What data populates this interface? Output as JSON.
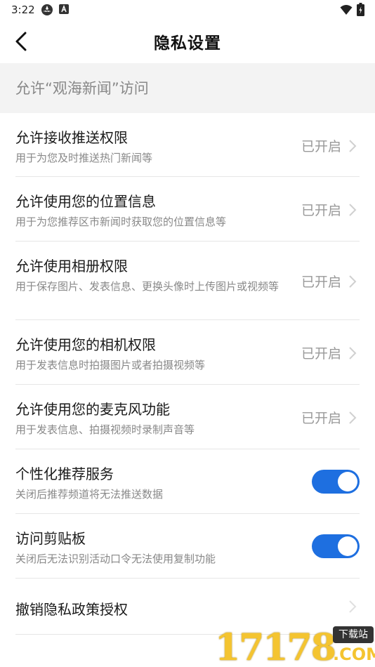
{
  "status_bar": {
    "time": "3:22"
  },
  "header": {
    "title": "隐私设置"
  },
  "section": {
    "label": "允许“观海新闻”访问"
  },
  "permissions": [
    {
      "title": "允许接收推送权限",
      "desc": "用于为您及时推送热门新闻等",
      "state": "已开启"
    },
    {
      "title": "允许使用您的位置信息",
      "desc": "用于为您推荐区市新闻时获取您的位置信息等",
      "state": "已开启"
    },
    {
      "title": "允许使用相册权限",
      "desc": "用于保存图片、发表信息、更换头像时上传图片或视频等",
      "state": "已开启"
    },
    {
      "title": "允许使用您的相机权限",
      "desc": "用于发表信息时拍摄图片或者拍摄视频等",
      "state": "已开启"
    },
    {
      "title": "允许使用您的麦克风功能",
      "desc": "用于发表信息、拍摄视频时录制声音等",
      "state": "已开启"
    }
  ],
  "toggles": [
    {
      "title": "个性化推荐服务",
      "desc": "关闭后推荐频道将无法推送数据",
      "on": true
    },
    {
      "title": "访问剪贴板",
      "desc": "关闭后无法识别活动口令无法使用复制功能",
      "on": true
    }
  ],
  "revoke": {
    "title": "撤销隐私政策授权"
  },
  "watermark": {
    "digits": "17178",
    "tag": "下载站",
    "domain": ".COM"
  },
  "colors": {
    "accent": "#1e6fe0",
    "section_bg": "#f3f3f3"
  }
}
